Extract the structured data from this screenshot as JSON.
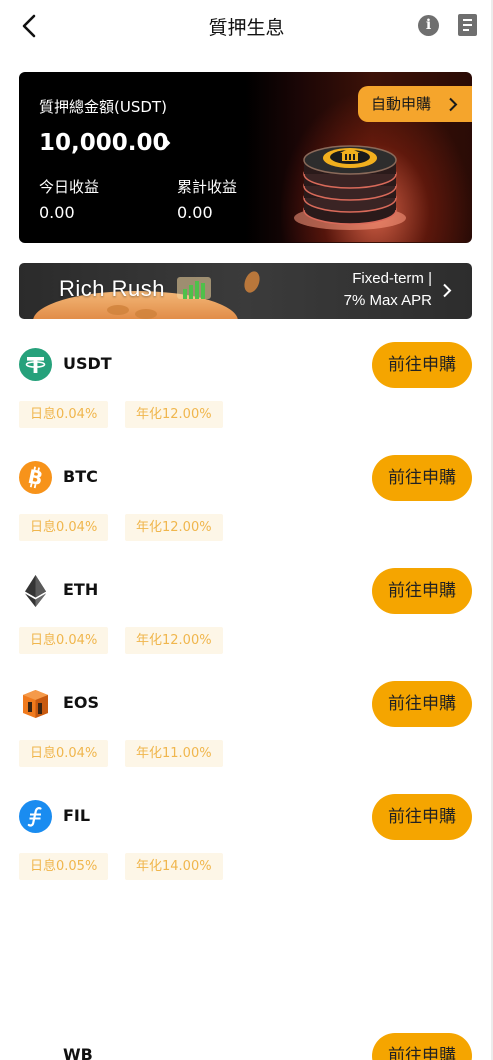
{
  "header": {
    "title": "質押生息"
  },
  "summary": {
    "total_label": "質押總金額(USDT)",
    "total_amount": "10,000.00",
    "today_label": "今日收益",
    "today_value": "0.00",
    "cumulative_label": "累計收益",
    "cumulative_value": "0.00",
    "auto_subscribe_label": "自動申購"
  },
  "banner": {
    "title": "Rich Rush",
    "line1": "Fixed-term |",
    "line2": "7% Max APR"
  },
  "coins": [
    {
      "name": "USDT",
      "button": "前往申購",
      "daily": "日息0.04%",
      "annual": "年化12.00%",
      "icon": "usdt-icon",
      "color": "#26a17b"
    },
    {
      "name": "BTC",
      "button": "前往申購",
      "daily": "日息0.04%",
      "annual": "年化12.00%",
      "icon": "btc-icon",
      "color": "#f7931a"
    },
    {
      "name": "ETH",
      "button": "前往申購",
      "daily": "日息0.04%",
      "annual": "年化12.00%",
      "icon": "eth-icon",
      "color": "#333333"
    },
    {
      "name": "EOS",
      "button": "前往申購",
      "daily": "日息0.04%",
      "annual": "年化11.00%",
      "icon": "eos-icon",
      "color": "#f07a1c"
    },
    {
      "name": "FIL",
      "button": "前往申購",
      "daily": "日息0.05%",
      "annual": "年化14.00%",
      "icon": "fil-icon",
      "color": "#1a8cf0"
    },
    {
      "name": "WB",
      "button": "前往申購"
    }
  ],
  "colors": {
    "accent": "#f5a500",
    "tag_bg": "#fdf6e7",
    "tag_text": "#f0b64d"
  }
}
